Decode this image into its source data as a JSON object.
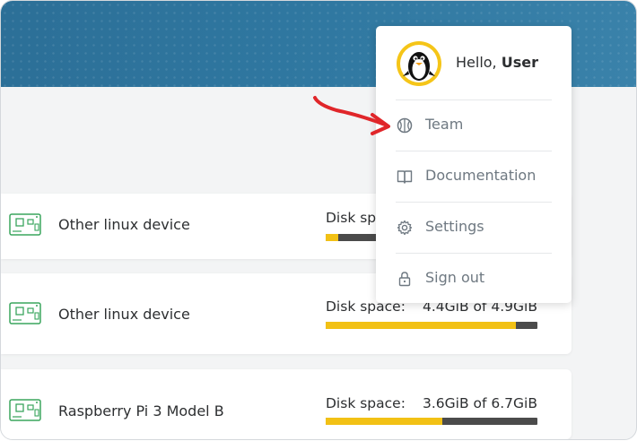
{
  "devices": [
    {
      "name": "Other linux device",
      "disk_label": "Disk space:",
      "disk_value": "",
      "disk_used_fraction": 0.06,
      "icon": "raspberry-board-icon"
    },
    {
      "name": "Other linux device",
      "disk_label": "Disk space:",
      "disk_value": "4.4GiB of 4.9GiB",
      "disk_used_fraction": 0.9,
      "icon": "raspberry-board-icon"
    },
    {
      "name": "Raspberry Pi 3 Model B",
      "disk_label": "Disk space:",
      "disk_value": "3.6GiB of 6.7GiB",
      "disk_used_fraction": 0.55,
      "icon": "raspberry-board-icon"
    }
  ],
  "user_menu": {
    "greeting": "Hello, ",
    "username": "User",
    "avatar_icon": "penguin-avatar-icon",
    "items": [
      {
        "label": "Team",
        "icon": "basketball-icon"
      },
      {
        "label": "Documentation",
        "icon": "book-icon"
      },
      {
        "label": "Settings",
        "icon": "gear-icon"
      },
      {
        "label": "Sign out",
        "icon": "lock-icon"
      }
    ]
  },
  "annotation": {
    "icon": "red-arrow-pointer"
  },
  "colors": {
    "header": "#2f77a0",
    "accent_yellow": "#f2c115",
    "bar_track": "#4b4b4b",
    "board_green": "#3aa55d",
    "annotation_red": "#e0262a"
  }
}
